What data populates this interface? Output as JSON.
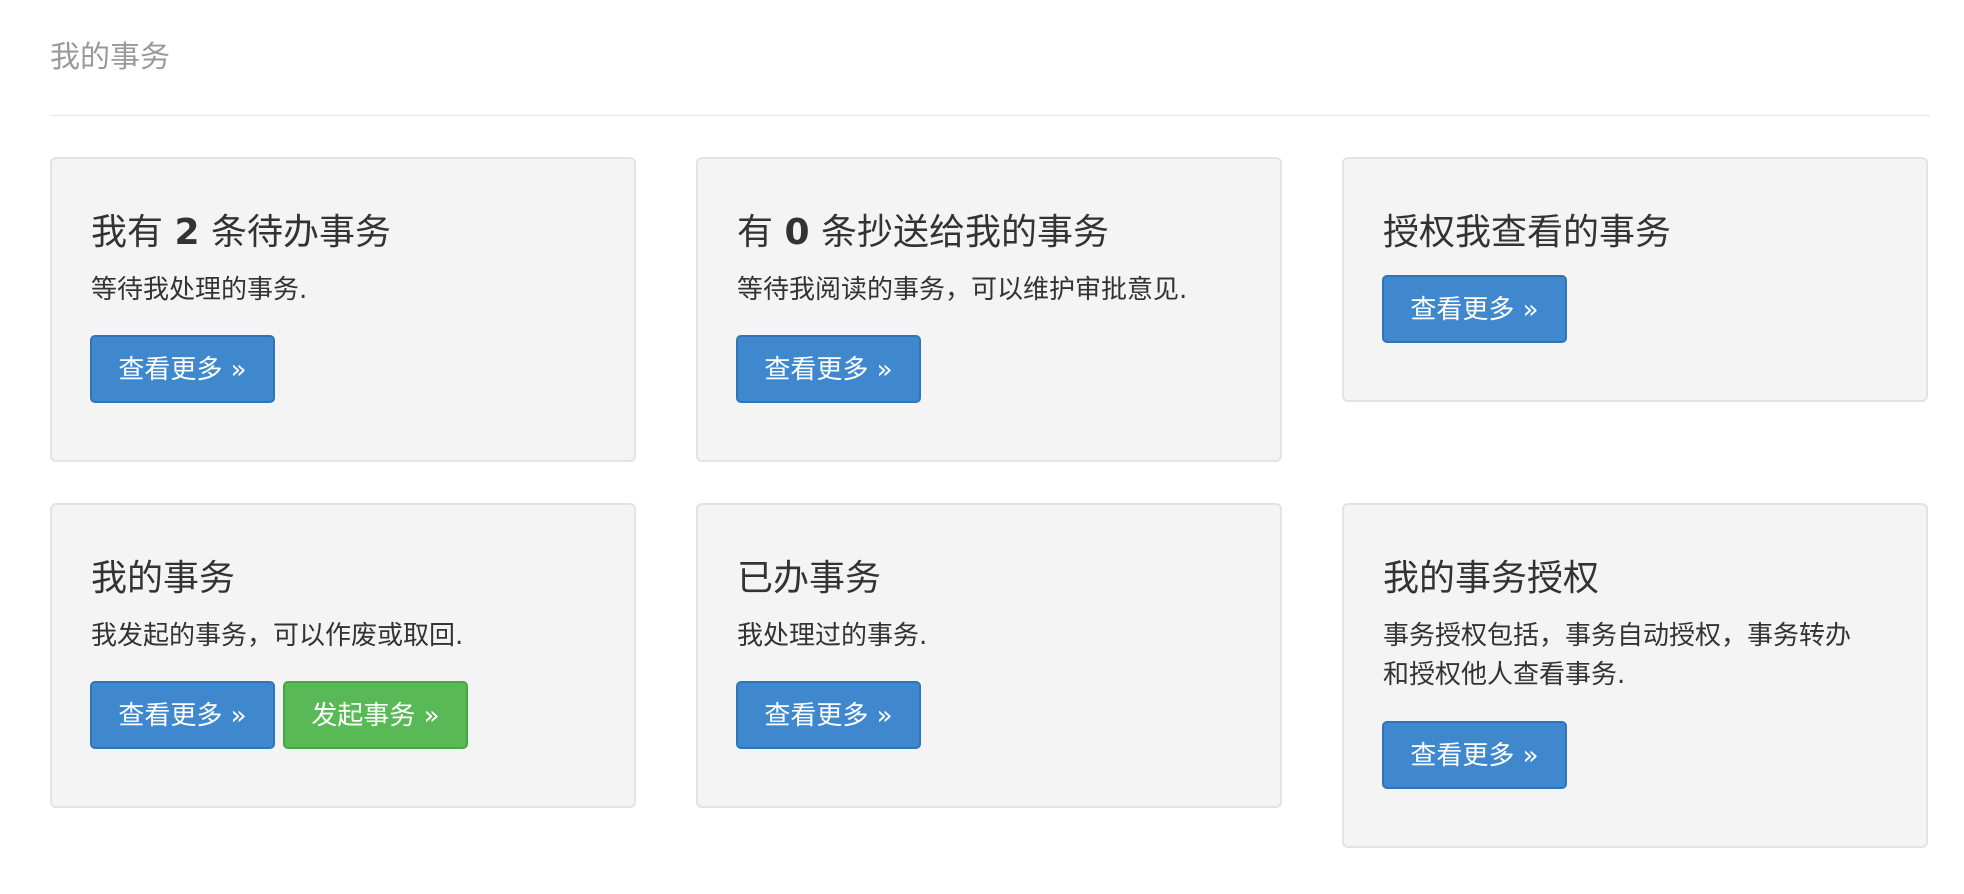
{
  "header": {
    "title": "我的事务"
  },
  "cards": [
    {
      "title_prefix": "我有 ",
      "title_count": "2",
      "title_suffix": " 条待办事务",
      "description": "等待我处理的事务.",
      "more_button": "查看更多 »"
    },
    {
      "title_prefix": "有 ",
      "title_count": "0",
      "title_suffix": " 条抄送给我的事务",
      "description": "等待我阅读的事务，可以维护审批意见.",
      "more_button": "查看更多 »"
    },
    {
      "title": "授权我查看的事务",
      "more_button": "查看更多 »"
    },
    {
      "title": "我的事务",
      "description": "我发起的事务，可以作废或取回.",
      "more_button": "查看更多 »",
      "start_button": "发起事务 »"
    },
    {
      "title": "已办事务",
      "description": "我处理过的事务.",
      "more_button": "查看更多 »"
    },
    {
      "title": "我的事务授权",
      "description_lines": [
        "事务授权包括，事务自动授权，事务转办",
        "和授权他人查看事务."
      ],
      "more_button": "查看更多 »"
    }
  ],
  "colors": {
    "primary_button": "#3f88ce",
    "success_button": "#58b956",
    "card_background": "#f4f4f4",
    "header_text": "#9a9a9a"
  }
}
